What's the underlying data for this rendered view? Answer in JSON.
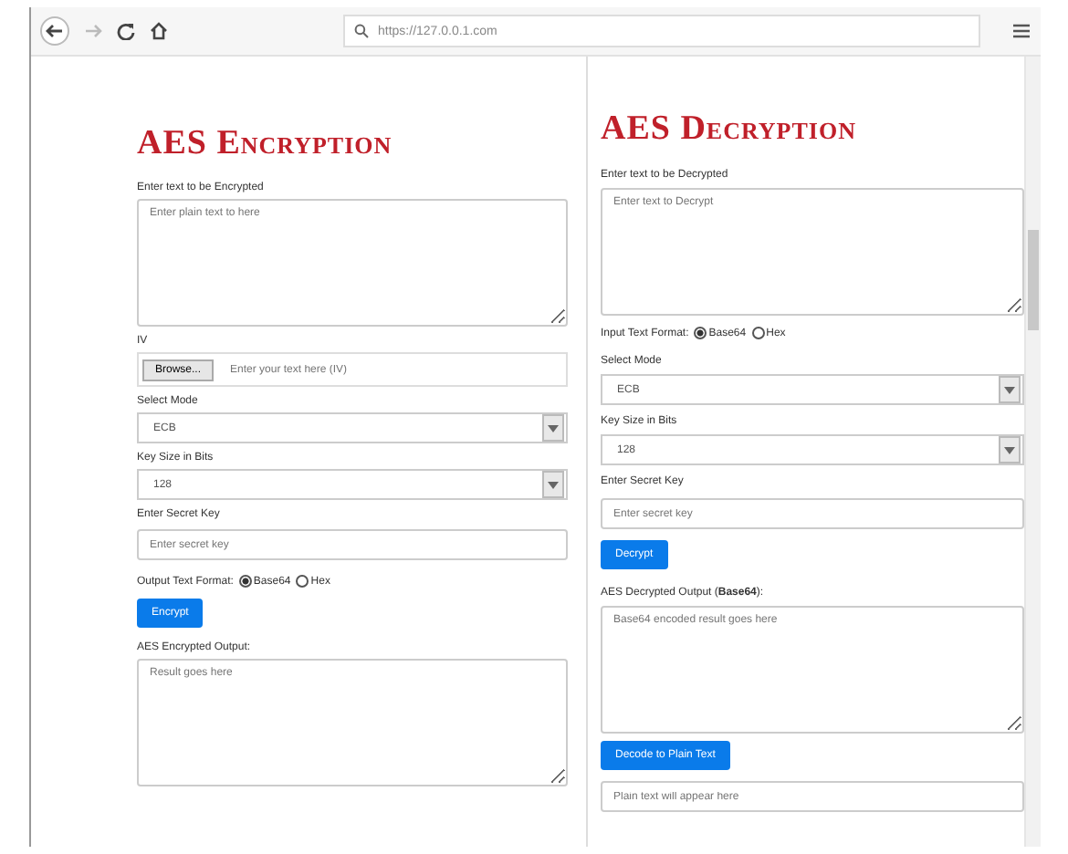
{
  "browser": {
    "url": "https://127.0.0.1.com"
  },
  "panels": [
    {
      "title": "AES Encryption",
      "items": [
        {
          "kind": "label",
          "text": "Enter text to be Encrypted"
        },
        {
          "kind": "textarea",
          "placeholder": "Enter plain text to here"
        },
        {
          "kind": "label",
          "text": "IV"
        },
        {
          "kind": "file",
          "button": "Browse...",
          "placeholder": "Enter your text here (IV)"
        },
        {
          "kind": "label",
          "text": "Select Mode"
        },
        {
          "kind": "select",
          "value": "ECB"
        },
        {
          "kind": "label",
          "text": "Key Size in Bits"
        },
        {
          "kind": "select",
          "value": "128"
        },
        {
          "kind": "label",
          "text": "Enter Secret Key"
        },
        {
          "kind": "input",
          "placeholder": "Enter secret key"
        },
        {
          "kind": "radio",
          "text": "Output Text Format:",
          "options": [
            {
              "label": "Base64",
              "selected": true
            },
            {
              "label": "Hex",
              "selected": false
            }
          ]
        },
        {
          "kind": "button",
          "text": "Encrypt"
        },
        {
          "kind": "label",
          "text": "AES Encrypted Output:"
        },
        {
          "kind": "textarea",
          "placeholder": "Result goes here"
        }
      ]
    },
    {
      "title": "AES Decryption",
      "items": [
        {
          "kind": "label",
          "text": "Enter text to be Decrypted"
        },
        {
          "kind": "textarea",
          "placeholder": "Enter text to Decrypt"
        },
        {
          "kind": "radio",
          "text": "Input Text Format:",
          "options": [
            {
              "label": "Base64",
              "selected": true
            },
            {
              "label": "Hex",
              "selected": false
            }
          ]
        },
        {
          "kind": "label",
          "text": "Select Mode"
        },
        {
          "kind": "select",
          "value": "ECB"
        },
        {
          "kind": "label",
          "text": "Key Size in Bits"
        },
        {
          "kind": "select",
          "value": "128"
        },
        {
          "kind": "label",
          "text": "Enter Secret Key"
        },
        {
          "kind": "input",
          "placeholder": "Enter secret key"
        },
        {
          "kind": "button",
          "text": "Decrypt"
        },
        {
          "kind": "label",
          "text": "AES Decrypted Output (**Base64**):"
        },
        {
          "kind": "textarea",
          "placeholder": "Base64 encoded result goes here"
        },
        {
          "kind": "button",
          "text": "Decode to Plain Text"
        },
        {
          "kind": "input",
          "placeholder": "Plain text will appear here"
        }
      ]
    }
  ]
}
